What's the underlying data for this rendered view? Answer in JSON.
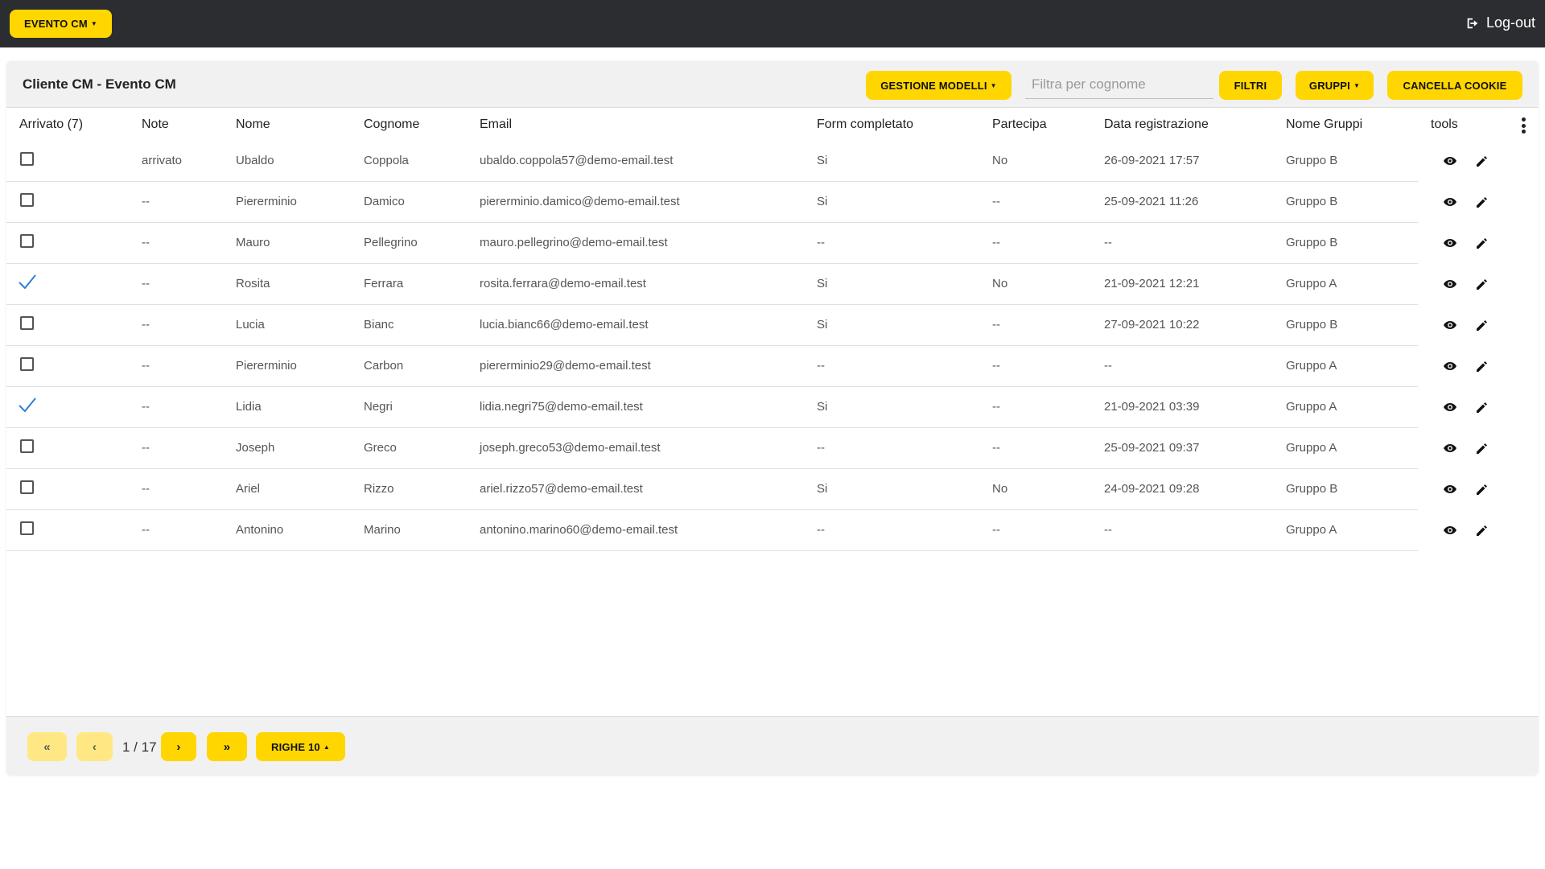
{
  "topbar": {
    "event_button": "EVENTO CM",
    "logout_label": "Log-out"
  },
  "card": {
    "title": "Cliente CM - Evento CM",
    "gestione_modelli": "GESTIONE MODELLI",
    "filter_placeholder": "Filtra per cognome",
    "filtri": "FILTRI",
    "gruppi": "GRUPPI",
    "cancella_cookie": "CANCELLA COOKIE"
  },
  "table": {
    "headers": [
      "Arrivato (7)",
      "Note",
      "Nome",
      "Cognome",
      "Email",
      "Form completato",
      "Partecipa",
      "Data registrazione",
      "Nome Gruppi",
      "tools"
    ],
    "rows": [
      {
        "arrived": false,
        "note": "arrivato",
        "nome": "Ubaldo",
        "cognome": "Coppola",
        "email": "ubaldo.coppola57@demo-email.test",
        "form": "Si",
        "partecipa": "No",
        "data": "26-09-2021 17:57",
        "gruppo": "Gruppo B"
      },
      {
        "arrived": false,
        "note": "--",
        "nome": "Piererminio",
        "cognome": "Damico",
        "email": "piererminio.damico@demo-email.test",
        "form": "Si",
        "partecipa": "--",
        "data": "25-09-2021 11:26",
        "gruppo": "Gruppo B"
      },
      {
        "arrived": false,
        "note": "--",
        "nome": "Mauro",
        "cognome": "Pellegrino",
        "email": "mauro.pellegrino@demo-email.test",
        "form": "--",
        "partecipa": "--",
        "data": "--",
        "gruppo": "Gruppo B"
      },
      {
        "arrived": true,
        "note": "--",
        "nome": "Rosita",
        "cognome": "Ferrara",
        "email": "rosita.ferrara@demo-email.test",
        "form": "Si",
        "partecipa": "No",
        "data": "21-09-2021 12:21",
        "gruppo": "Gruppo A"
      },
      {
        "arrived": false,
        "note": "--",
        "nome": "Lucia",
        "cognome": "Bianc",
        "email": "lucia.bianc66@demo-email.test",
        "form": "Si",
        "partecipa": "--",
        "data": "27-09-2021 10:22",
        "gruppo": "Gruppo B"
      },
      {
        "arrived": false,
        "note": "--",
        "nome": "Piererminio",
        "cognome": "Carbon",
        "email": "piererminio29@demo-email.test",
        "form": "--",
        "partecipa": "--",
        "data": "--",
        "gruppo": "Gruppo A"
      },
      {
        "arrived": true,
        "note": "--",
        "nome": "Lidia",
        "cognome": "Negri",
        "email": "lidia.negri75@demo-email.test",
        "form": "Si",
        "partecipa": "--",
        "data": "21-09-2021 03:39",
        "gruppo": "Gruppo A"
      },
      {
        "arrived": false,
        "note": "--",
        "nome": "Joseph",
        "cognome": "Greco",
        "email": "joseph.greco53@demo-email.test",
        "form": "--",
        "partecipa": "--",
        "data": "25-09-2021 09:37",
        "gruppo": "Gruppo A"
      },
      {
        "arrived": false,
        "note": "--",
        "nome": "Ariel",
        "cognome": "Rizzo",
        "email": "ariel.rizzo57@demo-email.test",
        "form": "Si",
        "partecipa": "No",
        "data": "24-09-2021 09:28",
        "gruppo": "Gruppo B"
      },
      {
        "arrived": false,
        "note": "--",
        "nome": "Antonino",
        "cognome": "Marino",
        "email": "antonino.marino60@demo-email.test",
        "form": "--",
        "partecipa": "--",
        "data": "--",
        "gruppo": "Gruppo A"
      }
    ]
  },
  "pagination": {
    "page_text": "1 / 17",
    "righe_label": "RIGHE 10"
  },
  "colors": {
    "accent": "#ffd600",
    "topbar": "#2b2d31",
    "check": "#2f7fd6"
  },
  "icons": [
    "logout-icon",
    "eye-icon",
    "pencil-icon",
    "check-icon",
    "kebab-icon",
    "first-page-icon",
    "prev-page-icon",
    "next-page-icon",
    "last-page-icon"
  ]
}
